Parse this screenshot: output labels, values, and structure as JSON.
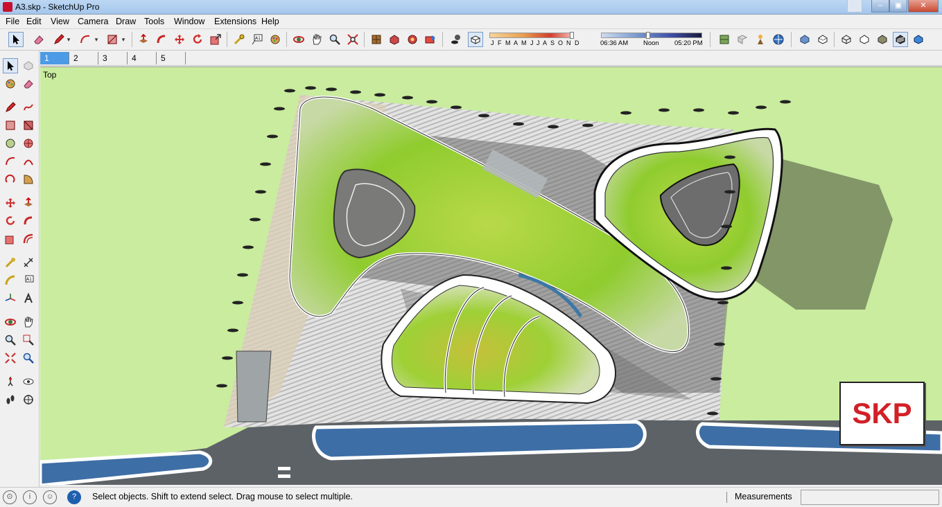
{
  "window": {
    "title": "A3.skp - SketchUp Pro",
    "minimize": "–",
    "maximize": "▣",
    "close": "✕"
  },
  "menu": [
    "File",
    "Edit",
    "View",
    "Camera",
    "Draw",
    "Tools",
    "Window",
    "Extensions",
    "Help"
  ],
  "shadow_settings": {
    "months": [
      "J",
      "F",
      "M",
      "A",
      "M",
      "J",
      "J",
      "A",
      "S",
      "O",
      "N",
      "D"
    ],
    "time_start": "06:36 AM",
    "time_mid": "Noon",
    "time_end": "05:20 PM"
  },
  "scenes": [
    "1",
    "2",
    "3",
    "4",
    "5"
  ],
  "active_scene": "1",
  "viewport": {
    "view_name": "Top",
    "badge": "SKP"
  },
  "status": {
    "help_icon": "?",
    "message": "Select objects. Shift to extend select. Drag mouse to select multiple.",
    "measurements_label": "Measurements",
    "measurements_value": ""
  },
  "colors": {
    "ground": "#c9ec9e",
    "road": "#5d6266",
    "water": "#3e6ea6",
    "roof_green": "#9ccf3a",
    "paving": "#d8d8d8",
    "badge_red": "#d22027"
  },
  "icons": {
    "toolbar": [
      "select-icon",
      "eraser-icon",
      "pencil-icon",
      "arc-icon",
      "rectangle-icon",
      "push-pull-icon",
      "follow-me-icon",
      "move-icon",
      "rotate-icon",
      "scale-icon",
      "tape-measure-icon",
      "text-icon",
      "paint-bucket-icon",
      "orbit-icon",
      "pan-icon",
      "zoom-icon",
      "zoom-extents-icon",
      "warehouse-icon",
      "share-model-icon",
      "components-icon",
      "extension-warehouse-icon",
      "shadows-icon",
      "fog-icon",
      "geo-location-icon",
      "add-location-icon",
      "photo-texture-icon",
      "layout-icon",
      "xray-icon",
      "back-edges-icon",
      "wireframe-icon",
      "hidden-line-icon",
      "shaded-icon",
      "shaded-textures-icon",
      "monochrome-icon"
    ]
  }
}
